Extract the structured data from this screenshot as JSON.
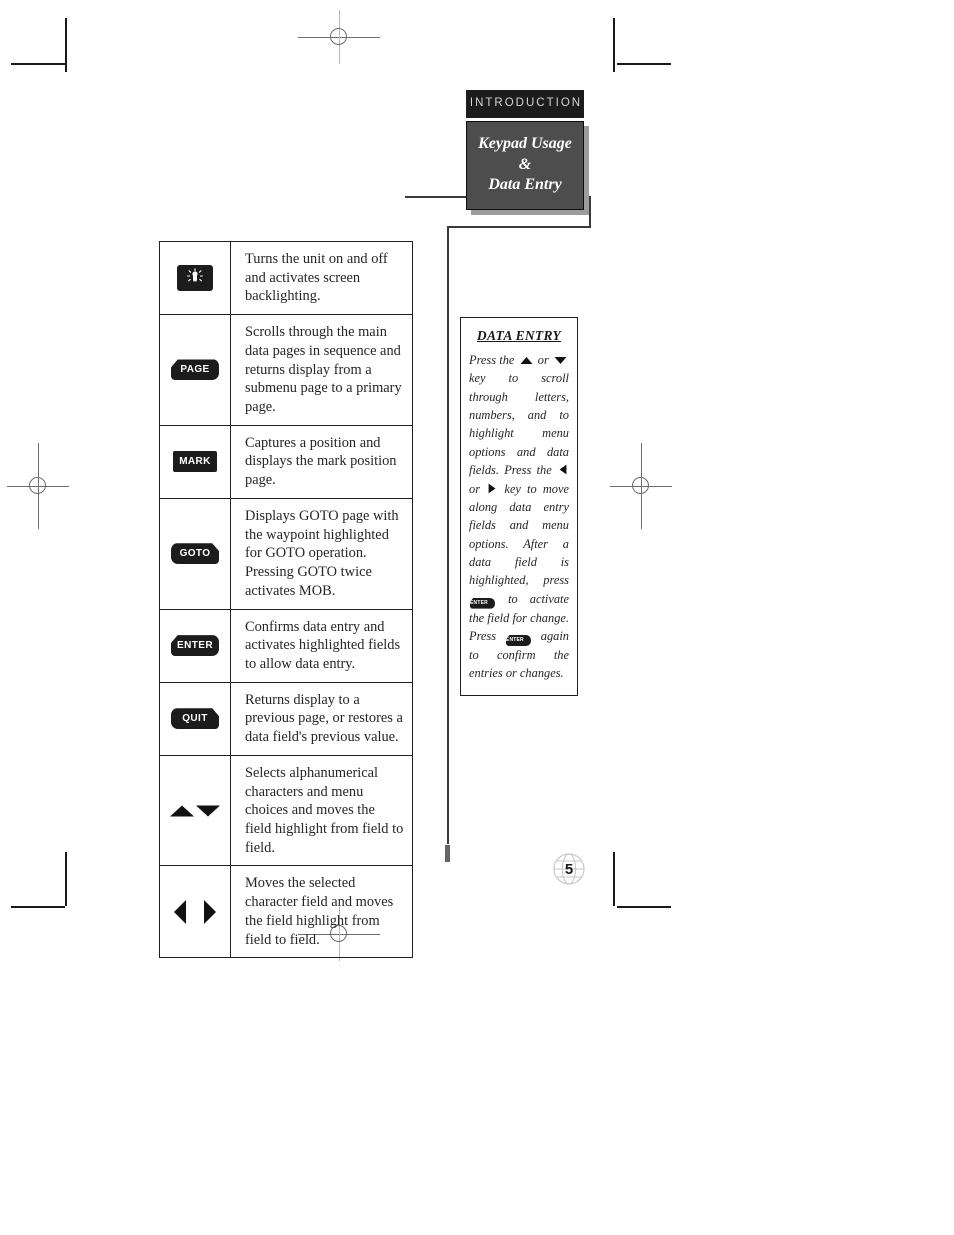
{
  "header": {
    "section_label": "INTRODUCTION",
    "tab_title_line1": "Keypad Usage &",
    "tab_title_line2": "Data Entry"
  },
  "keypad_table": {
    "rows": [
      {
        "key_name": "power-backlight-key",
        "key_label": "",
        "key_style": "power",
        "description": "Turns the unit on and off and activates screen backlighting."
      },
      {
        "key_name": "page-key",
        "key_label": "PAGE",
        "key_style": "left-wedge",
        "description": "Scrolls through the main data pages in sequence and returns display from a submenu page to a primary page."
      },
      {
        "key_name": "mark-key",
        "key_label": "MARK",
        "key_style": "rect",
        "description": "Captures a position and displays the mark position page."
      },
      {
        "key_name": "goto-key",
        "key_label": "GOTO",
        "key_style": "right-wedge",
        "description": "Displays GOTO page with the waypoint highlighted for GOTO operation. Pressing GOTO twice activates MOB."
      },
      {
        "key_name": "enter-key",
        "key_label": "ENTER",
        "key_style": "left-wedge",
        "description": "Confirms data entry and activates highlighted fields to allow data entry."
      },
      {
        "key_name": "quit-key",
        "key_label": "QUIT",
        "key_style": "right-wedge",
        "description": "Returns display to a previous page, or restores a data field's previous value."
      },
      {
        "key_name": "up-down-arrow-keys",
        "key_label": "",
        "key_style": "updown-arrows",
        "description": "Selects alphanumerical characters and menu choices and moves the field highlight from field to field."
      },
      {
        "key_name": "left-right-arrow-keys",
        "key_label": "",
        "key_style": "leftright-arrows",
        "description": "Moves the selected character field and moves the field highlight from field to field."
      }
    ]
  },
  "sidebar": {
    "title": "DATA ENTRY",
    "text_part1": "Press the",
    "text_or1": "or",
    "text_part2": "key to scroll through letters, numbers, and to highlight menu options and data fields. Press the",
    "text_or2": "or",
    "text_part3": "key to move along data entry fields and menu options. After a data field is highlighted, press",
    "text_part4": "to activate the field for change. Press",
    "inline_key_label": "ENTER",
    "text_part5": "again to confirm the entries or changes."
  },
  "footer": {
    "page_number": "5"
  }
}
